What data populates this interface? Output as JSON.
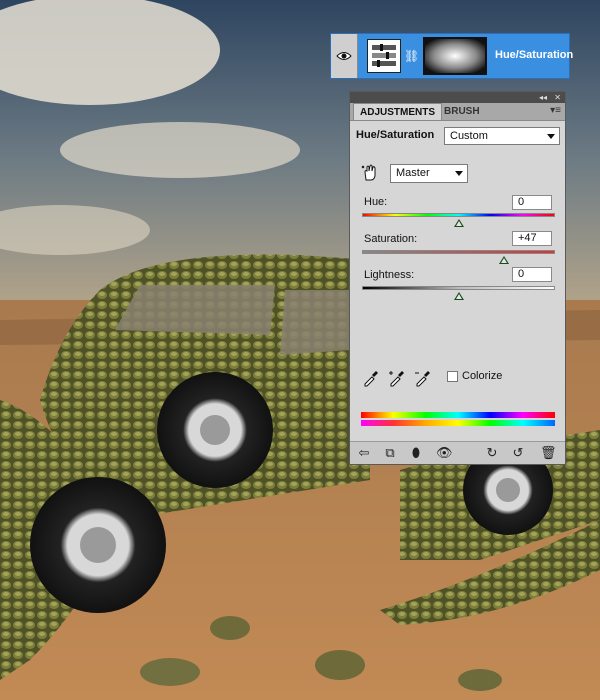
{
  "layer": {
    "name": "Hue/Saturation",
    "eye_icon": "eye-icon",
    "link_icon": "chain-link-icon"
  },
  "panel": {
    "tabs": [
      "ADJUSTMENTS",
      "BRUSH"
    ],
    "active_tab": "ADJUSTMENTS",
    "title": "Hue/Saturation",
    "preset": "Custom",
    "channel": "Master",
    "sliders": {
      "hue": {
        "label": "Hue:",
        "value": "0",
        "fraction": 0.5
      },
      "saturation": {
        "label": "Saturation:",
        "value": "+47",
        "fraction": 0.735
      },
      "lightness": {
        "label": "Lightness:",
        "value": "0",
        "fraction": 0.5
      }
    },
    "colorize_label": "Colorize",
    "colorize_checked": false
  },
  "colors": {
    "layer_selected": "#3a8fe0",
    "panel_bg": "#d6d6d6",
    "titlebar": "#4c4c4c"
  }
}
